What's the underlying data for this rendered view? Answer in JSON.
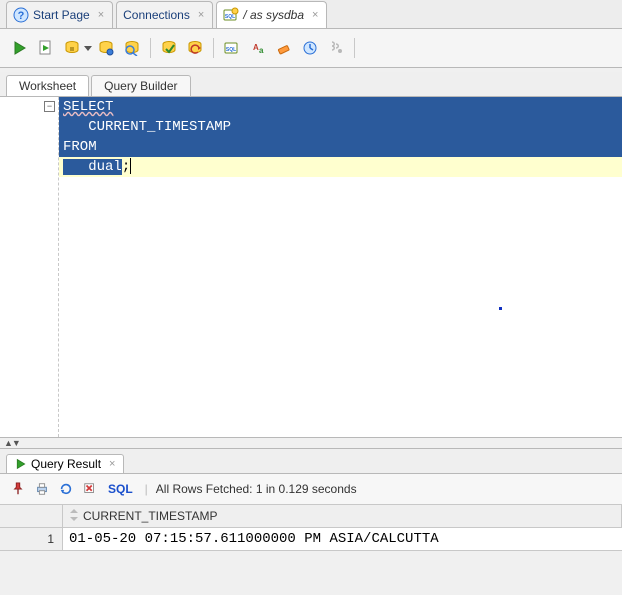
{
  "tabs": {
    "start_page": "Start Page",
    "connections": "Connections",
    "session": "/ as sysdba"
  },
  "ws_tabs": {
    "worksheet": "Worksheet",
    "query_builder": "Query Builder"
  },
  "editor": {
    "line1": "SELECT",
    "line2": "   CURRENT_TIMESTAMP",
    "line3": "FROM",
    "line4_a": "   dual",
    "line4_b": ";"
  },
  "result_tab": {
    "label": "Query Result"
  },
  "result_toolbar": {
    "sql_label": "SQL",
    "status": "All Rows Fetched: 1 in 0.129 seconds"
  },
  "grid": {
    "column": "CURRENT_TIMESTAMP",
    "rownum": "1",
    "value": "01-05-20 07:15:57.611000000 PM ASIA/CALCUTTA"
  }
}
